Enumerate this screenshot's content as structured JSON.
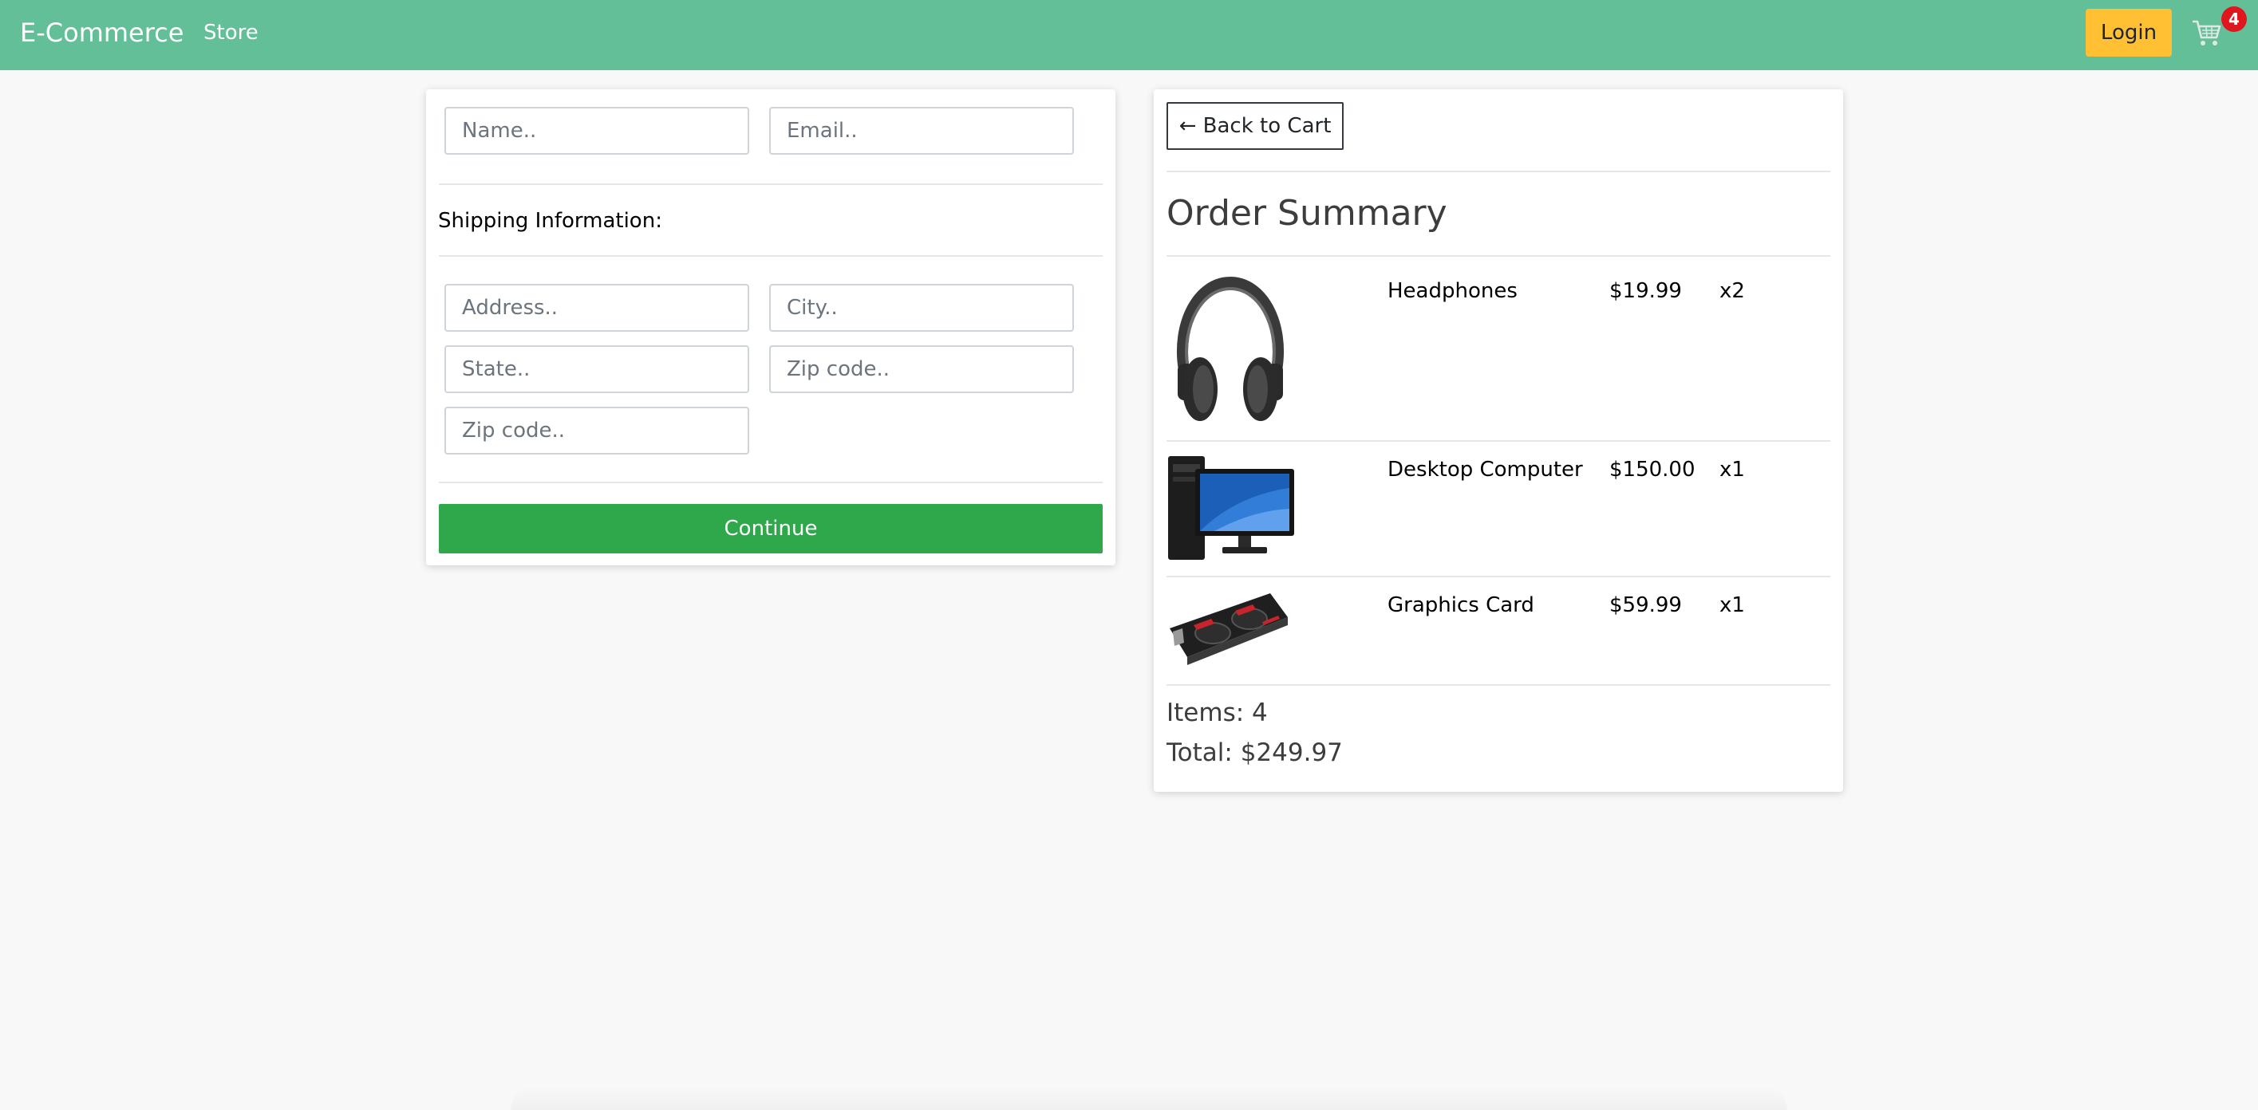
{
  "navbar": {
    "brand": "E-Commerce",
    "store_link": "Store",
    "login_label": "Login",
    "cart_count": "4",
    "cart_icon": "cart-icon",
    "background": "#62bf98",
    "login_color": "#ffc133",
    "badge_color": "#e0161f"
  },
  "form": {
    "name_placeholder": "Name..",
    "email_placeholder": "Email..",
    "shipping_label": "Shipping Information:",
    "address_placeholder": "Address..",
    "city_placeholder": "City..",
    "state_placeholder": "State..",
    "zip_placeholder": "Zip code..",
    "zip2_placeholder": "Zip code..",
    "continue_label": "Continue",
    "continue_color": "#2ea84b"
  },
  "summary": {
    "back_label": "← Back to Cart",
    "title": "Order Summary",
    "items": [
      {
        "name": "Headphones",
        "price": "$19.99",
        "qty": "x2",
        "image": "headphones"
      },
      {
        "name": "Desktop Computer",
        "price": "$150.00",
        "qty": "x1",
        "image": "desktop-computer"
      },
      {
        "name": "Graphics Card",
        "price": "$59.99",
        "qty": "x1",
        "image": "graphics-card"
      }
    ],
    "items_total": "Items: 4",
    "total": "Total: $249.97"
  }
}
